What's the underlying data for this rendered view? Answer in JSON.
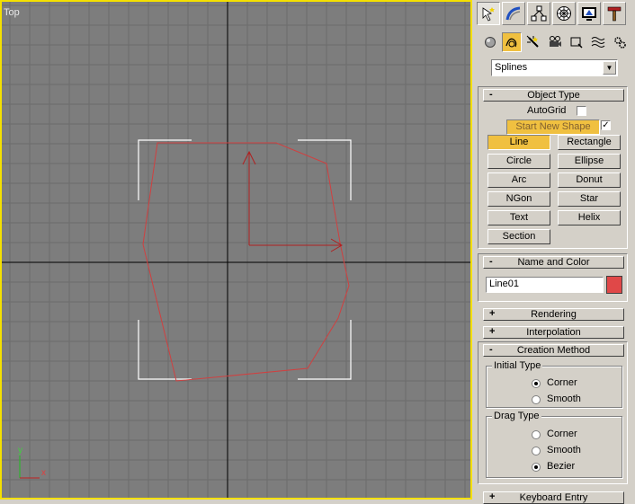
{
  "viewport": {
    "label": "Top",
    "axis_x": "x",
    "axis_y": "y"
  },
  "panel": {
    "tabs": [
      "create-icon",
      "modify-icon",
      "hierarchy-icon",
      "motion-icon",
      "display-icon",
      "utilities-icon"
    ],
    "subcategories": [
      "geometry-icon",
      "shapes-icon",
      "lights-icon",
      "cameras-icon",
      "helpers-icon",
      "spacewarps-icon",
      "systems-icon"
    ],
    "category_select": "Splines",
    "object_type": {
      "sign": "-",
      "title": "Object Type",
      "autogrid_label": "AutoGrid",
      "start_new_shape": "Start New Shape",
      "start_new_shape_checked": "✓",
      "buttons": [
        "Line",
        "Rectangle",
        "Circle",
        "Ellipse",
        "Arc",
        "Donut",
        "NGon",
        "Star",
        "Text",
        "Helix",
        "Section"
      ]
    },
    "name_color": {
      "sign": "-",
      "title": "Name and Color",
      "name_value": "Line01",
      "color": "#e04848"
    },
    "rendering": {
      "sign": "+",
      "title": "Rendering"
    },
    "interpolation": {
      "sign": "+",
      "title": "Interpolation"
    },
    "creation_method": {
      "sign": "-",
      "title": "Creation Method",
      "initial_type_label": "Initial Type",
      "initial_options": [
        "Corner",
        "Smooth"
      ],
      "initial_selected": "Corner",
      "drag_type_label": "Drag Type",
      "drag_options": [
        "Corner",
        "Smooth",
        "Bezier"
      ],
      "drag_selected": "Bezier"
    },
    "keyboard_entry": {
      "sign": "+",
      "title": "Keyboard Entry"
    }
  },
  "colors": {
    "viewport_bg": "#7d7d7d",
    "active_border": "#f5e000",
    "spline": "#d04040",
    "active_button": "#f0c040"
  }
}
